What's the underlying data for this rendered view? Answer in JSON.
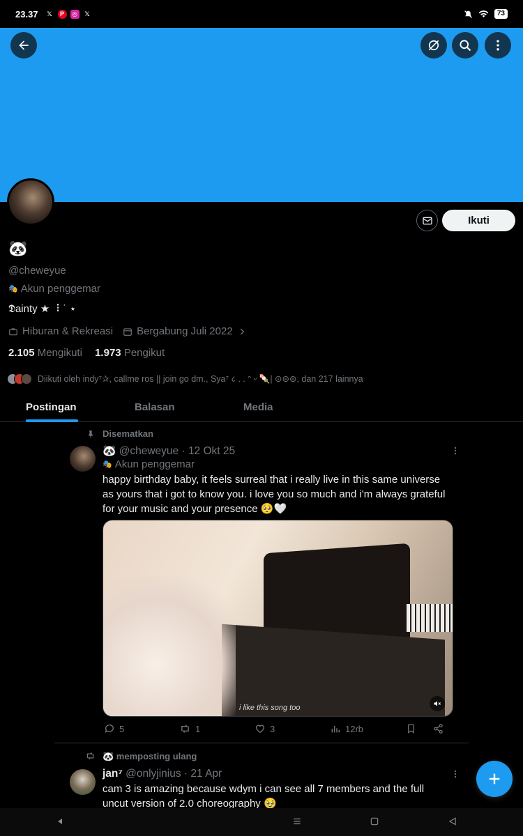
{
  "status_bar": {
    "time": "23.37",
    "apps": [
      "X",
      "P",
      "IG",
      "X"
    ],
    "battery": "73"
  },
  "header": {
    "icons": [
      "back-arrow-icon",
      "grok-icon",
      "search-icon",
      "more-vertical-icon"
    ],
    "banner_color": "#1d9bf0"
  },
  "profile": {
    "display_name": "🐼",
    "handle": "@cheweyue",
    "badge": "Akun penggemar",
    "bio": "𝕯ainty ★ ⠸ ˙ ⋆",
    "category": "Hiburan & Rekreasi",
    "joined": "Bergabung Juli 2022",
    "following_count": "2.105",
    "following_label": "Mengikuti",
    "followers_count": "1.973",
    "followers_label": "Pengikut",
    "followed_by": "Diikuti oleh indy⁷✰, callme ros || join go dm., Sya⁷ ८ . . ᵔ ᵕ 🍡| ⊙⊝⊜, dan 217 lainnya",
    "follow_button": "Ikuti"
  },
  "tabs": [
    {
      "label": "Postingan",
      "active": true
    },
    {
      "label": "Balasan",
      "active": false
    },
    {
      "label": "Media",
      "active": false
    }
  ],
  "pinned_tweet": {
    "pinned_label": "Disematkan",
    "author_emoji": "🐼",
    "handle": "@cheweyue",
    "date": "12 Okt 25",
    "badge": "Akun penggemar",
    "text": "happy birthday baby, it feels surreal that i really live in this same universe as yours that i got to know you. i love you so much and i'm always grateful for your music and your presence 🥺🤍",
    "media_caption": "i like this song too",
    "replies": "5",
    "reposts": "1",
    "likes": "3",
    "views": "12rb"
  },
  "repost": {
    "label": "🐼 memposting ulang",
    "author": "jan⁷",
    "handle": "@onlyjinius",
    "date": "21 Apr",
    "text": "cam 3 is amazing because wdym i can see all 7 members and the full uncut version of 2.0 choreography 🥹"
  },
  "colors": {
    "accent": "#1d9bf0",
    "background": "#000000",
    "muted": "#71767b"
  }
}
